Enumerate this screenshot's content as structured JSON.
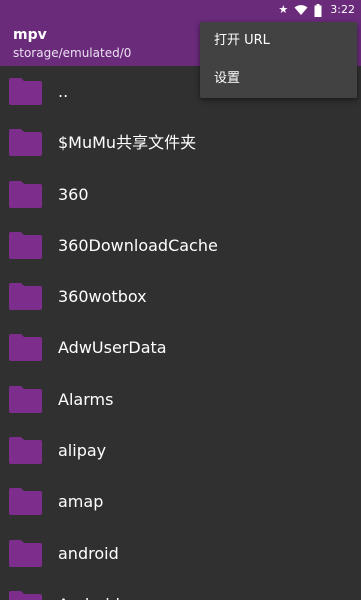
{
  "status_bar": {
    "icons": [
      "star-icon",
      "wifi-icon",
      "battery-icon"
    ],
    "time": "3:22"
  },
  "app_bar": {
    "title": "mpv",
    "subtitle": "storage/emulated/0",
    "color": "#6a2b7b"
  },
  "menu": {
    "items": [
      {
        "label": "打开 URL"
      },
      {
        "label": "设置"
      }
    ]
  },
  "files": [
    {
      "name": ".."
    },
    {
      "name": "$MuMu共享文件夹"
    },
    {
      "name": "360"
    },
    {
      "name": "360DownloadCache"
    },
    {
      "name": "360wotbox"
    },
    {
      "name": "AdwUserData"
    },
    {
      "name": "Alarms"
    },
    {
      "name": "alipay"
    },
    {
      "name": "amap"
    },
    {
      "name": "android"
    },
    {
      "name": "Android"
    }
  ],
  "colors": {
    "folder": "#7d2d8c",
    "background": "#303030",
    "menu_background": "#424242"
  }
}
